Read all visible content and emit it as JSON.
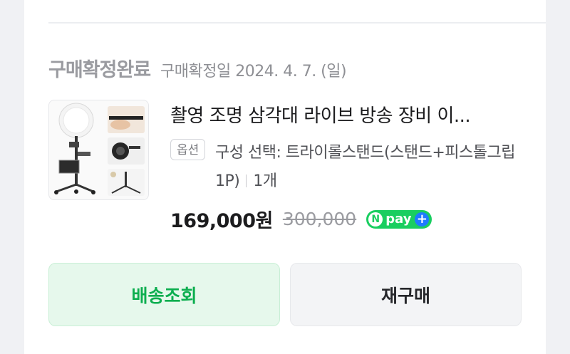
{
  "order": {
    "status_title": "구매확정완료",
    "status_date": "구매확정일 2024. 4. 7. (일)"
  },
  "product": {
    "name": "촬영 조명 삼각대 라이브 방송 장비 이...",
    "option_badge": "옵션",
    "option_text": "구성 선택: 트라이롤스탠드(스탠드+피스톨그립1P)",
    "quantity": "1개",
    "price": "169,000원",
    "original_price": "300,000"
  },
  "npay": {
    "n": "N",
    "label": "pay",
    "plus": "+",
    "color": "#19ce60",
    "plus_color": "#1e7bff"
  },
  "buttons": {
    "track": "배송조회",
    "reorder": "재구매"
  },
  "colors": {
    "accent_green": "#0cae4f",
    "track_bg": "#e6f8ec",
    "reorder_bg": "#f3f4f6"
  }
}
